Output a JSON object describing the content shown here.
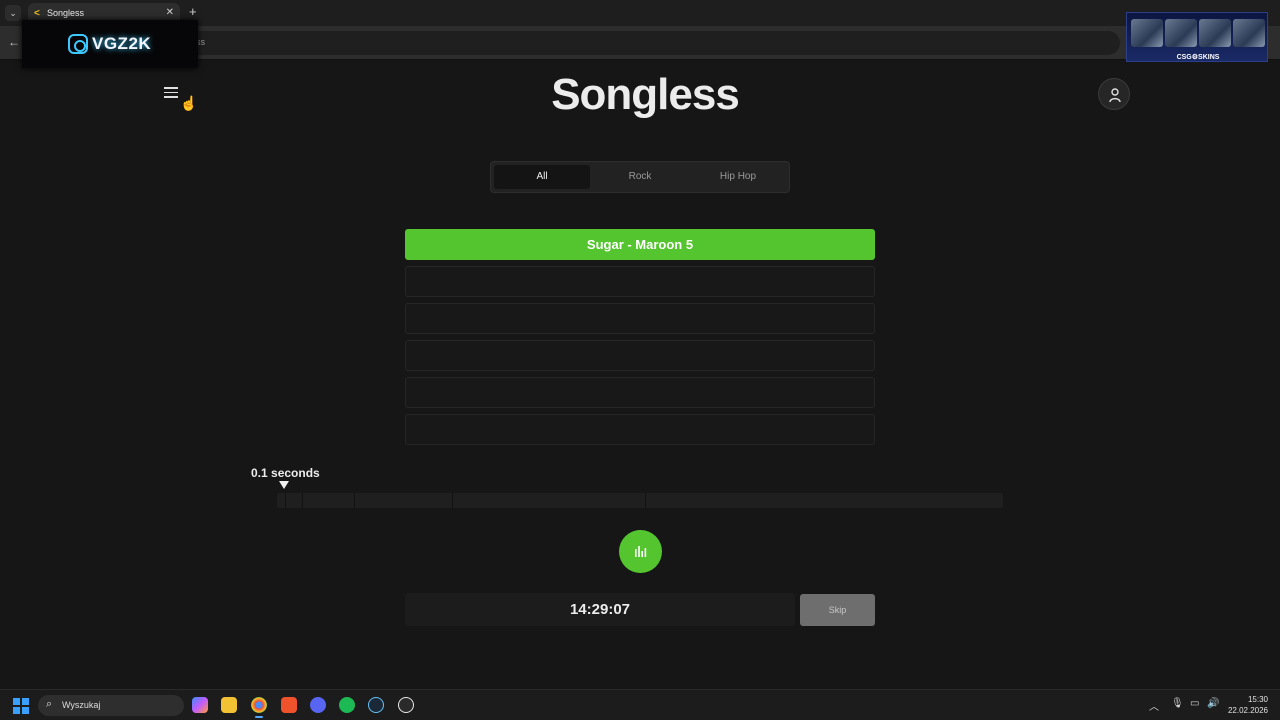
{
  "browser": {
    "tab_title": "Songless",
    "new_tab_symbol": "+",
    "omnibox_text_fragment": "ss",
    "window_controls_text": "— ❐"
  },
  "overlays": {
    "streamer_logo_text": "VGZ2K",
    "sponsor_text": "CSG⚙SKINS"
  },
  "app": {
    "title": "Songless",
    "genre_tabs": [
      "All",
      "Rock",
      "Hip Hop"
    ],
    "active_genre_index": 0,
    "guesses": [
      {
        "text": "Sugar - Maroon 5",
        "status": "correct"
      },
      {
        "text": "",
        "status": "empty"
      },
      {
        "text": "",
        "status": "empty"
      },
      {
        "text": "",
        "status": "empty"
      },
      {
        "text": "",
        "status": "empty"
      },
      {
        "text": "",
        "status": "empty"
      }
    ],
    "duration_label": "0.1 seconds",
    "countdown": "14:29:07",
    "skip_label": "Skip"
  },
  "colors": {
    "accent": "#54c52e",
    "background": "#161616",
    "skip_disabled": "#6e6e6e"
  },
  "taskbar": {
    "search_placeholder": "Wyszukaj",
    "pinned_apps": [
      "copilot-icon",
      "file-explorer-icon",
      "chrome-icon",
      "brave-icon",
      "discord-icon",
      "spotify-icon",
      "steam-icon",
      "chatgpt-icon"
    ],
    "time": "15:30",
    "date": "22.02.2026"
  }
}
